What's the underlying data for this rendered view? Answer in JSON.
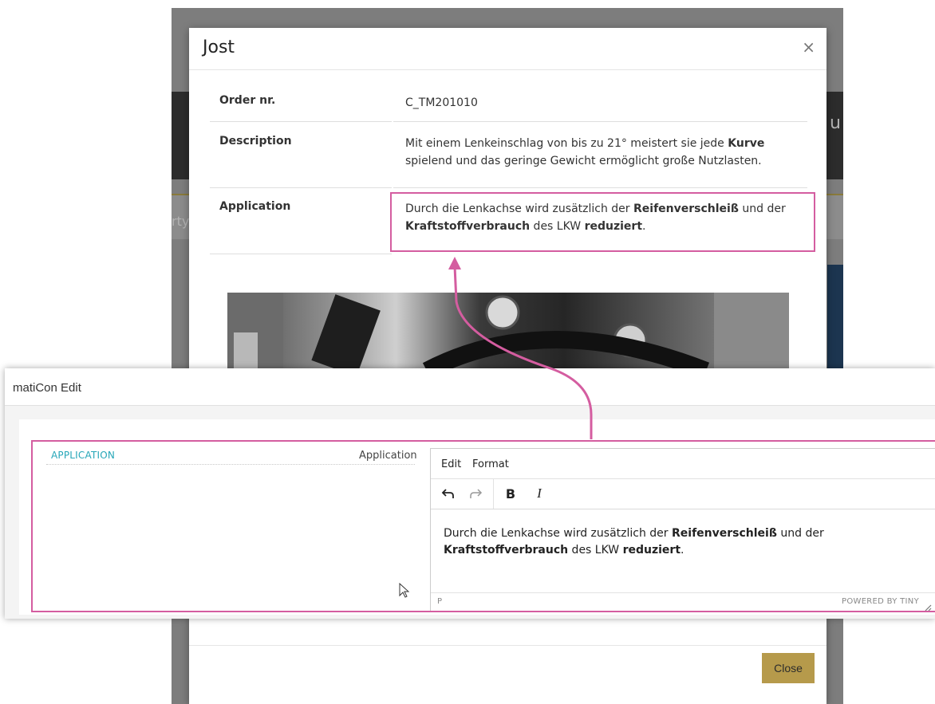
{
  "background": {
    "edge_text_left": "rty",
    "edge_text_right": "u"
  },
  "modal": {
    "title": "Jost",
    "close_icon": "close-icon",
    "rows": [
      {
        "label": "Order nr.",
        "value": "C_TM201010"
      },
      {
        "label": "Description",
        "value_parts": [
          "Mit einem Lenkeinschlag von bis zu 21° meistert sie jede ",
          "Kurve",
          " spielend und das geringe Gewicht ermöglicht große Nutzlasten."
        ]
      },
      {
        "label": "Application",
        "value_parts": [
          "Durch die Lenkachse wird zusätzlich der ",
          "Reifenverschleiß",
          " und der ",
          "Kraftstoffverbrauch",
          " des LKW ",
          "reduziert",
          "."
        ]
      }
    ],
    "close_button": "Close"
  },
  "editor": {
    "window_title": "matiCon Edit",
    "field_label": "APPLICATION",
    "field_caption": "Application",
    "menu": [
      "Edit",
      "Format"
    ],
    "toolbar": {
      "undo_icon": "undo-icon",
      "redo_icon": "redo-icon",
      "bold": "B",
      "italic": "I"
    },
    "content_parts": [
      "Durch die Lenkachse wird zusätzlich der ",
      "Reifenverschleiß",
      " und der ",
      "Kraftstoffverbrauch",
      " des LKW ",
      "reduziert",
      "."
    ],
    "status_path": "P",
    "powered_by": "POWERED BY TINY"
  },
  "colors": {
    "highlight": "#d45da0",
    "accent_button": "#b69a4b",
    "field_label": "#26a6b8"
  }
}
